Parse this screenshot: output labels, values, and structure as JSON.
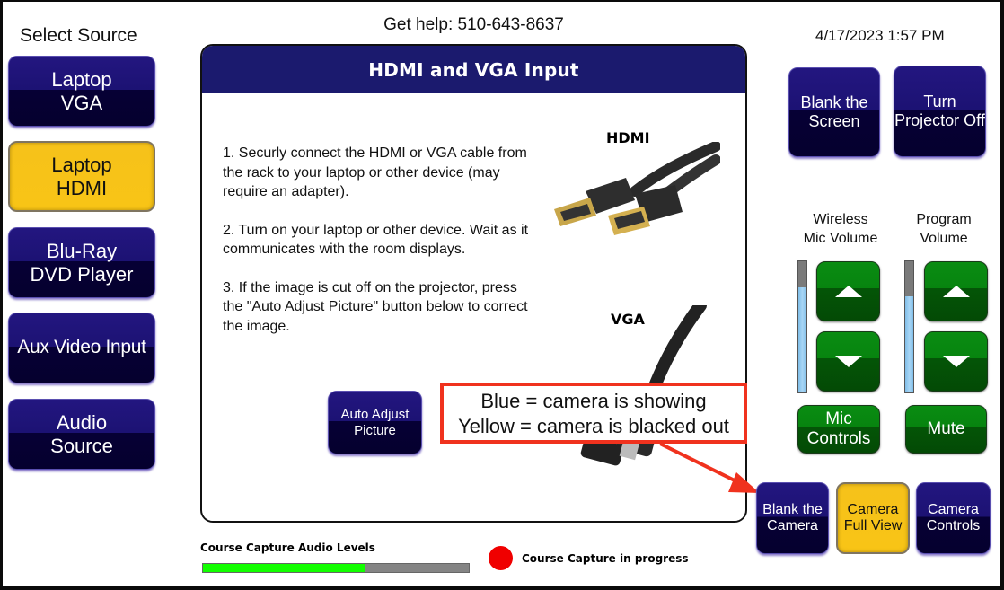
{
  "header": {
    "select_source_label": "Select Source",
    "help_text": "Get help: 510-643-8637",
    "datetime": "4/17/2023 1:57 PM"
  },
  "sources": [
    {
      "label": "Laptop\nVGA",
      "selected": false
    },
    {
      "label": "Laptop\nHDMI",
      "selected": true
    },
    {
      "label": "Blu-Ray\nDVD Player",
      "selected": false
    },
    {
      "label": "Aux Video Input",
      "selected": false
    },
    {
      "label": "Audio\nSource",
      "selected": false
    }
  ],
  "panel": {
    "title": "HDMI and VGA Input",
    "steps": [
      "1. Securly connect the HDMI or VGA cable from the rack to your laptop or other device (may require an adapter).",
      "2. Turn on your laptop or other device. Wait as it communicates with the room displays.",
      "3. If the image is cut off on the projector, press the \"Auto Adjust Picture\" button below to correct the image."
    ],
    "hdmi_label": "HDMI",
    "vga_label": "VGA",
    "auto_adjust_label": "Auto Adjust\nPicture"
  },
  "callout": {
    "line1": "Blue = camera is showing",
    "line2": "Yellow = camera is blacked out",
    "color": "#f0321e"
  },
  "display_controls": {
    "blank_screen_label": "Blank the\nScreen",
    "projector_off_label": "Turn\nProjector Off"
  },
  "volume": {
    "mic_label": "Wireless\nMic Volume",
    "mic_level_pct": 80,
    "program_label": "Program\nVolume",
    "program_level_pct": 73,
    "mic_controls_label": "Mic\nControls",
    "mute_label": "Mute",
    "up_icon": "triangle-up",
    "down_icon": "triangle-down"
  },
  "camera": {
    "blank_camera_label": "Blank the\nCamera",
    "full_view_label": "Camera\nFull View",
    "full_view_active": true,
    "controls_label": "Camera\nControls"
  },
  "course_capture": {
    "audio_levels_label": "Course Capture Audio Levels",
    "audio_level_pct": 61,
    "status_label": "Course Capture in progress",
    "status_color": "#f00000"
  },
  "colors": {
    "button_blue": "#1c1273",
    "button_yellow": "#f8c416",
    "button_green": "#07840f",
    "panel_header": "#1b1a6e"
  }
}
